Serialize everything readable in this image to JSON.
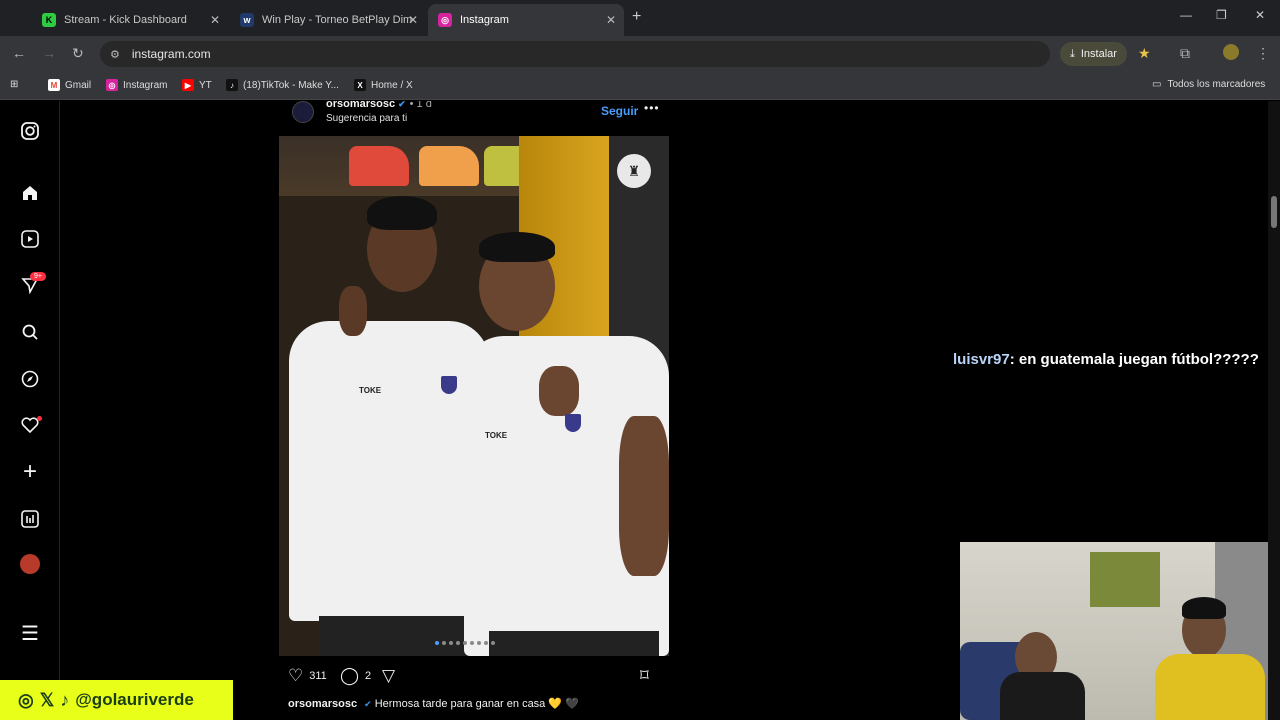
{
  "browser": {
    "tabs": [
      {
        "title": "Stream - Kick Dashboard",
        "icon": "kick-icon",
        "fav_letter": "K",
        "fav_color": "#2ecc40"
      },
      {
        "title": "Win Play - Torneo BetPlay Dima",
        "icon": "winplay-icon",
        "fav_letter": "w",
        "fav_color": "#203a6a"
      },
      {
        "title": "Instagram",
        "icon": "instagram-icon",
        "fav_letter": "◎",
        "fav_color": "#d6249f"
      }
    ],
    "active_tab": 2,
    "url": "instagram.com",
    "install_label": "Instalar",
    "bookmarks": [
      {
        "label": "Gmail",
        "letter": "M",
        "color": "#ea4335"
      },
      {
        "label": "Instagram",
        "letter": "◎",
        "color": "#d6249f"
      },
      {
        "label": "YT",
        "letter": "▶",
        "color": "#ff0000"
      },
      {
        "label": "(18)TikTok - Make Y...",
        "letter": "♪",
        "color": "#111111"
      },
      {
        "label": "Home / X",
        "letter": "X",
        "color": "#111111"
      }
    ],
    "all_bookmarks_label": "Todos los marcadores"
  },
  "sidebar": {
    "notification_badge": "9+"
  },
  "post": {
    "username": "orsomarsosc",
    "time": "• 1 d",
    "suggestion": "Sugerencia para ti",
    "follow_label": "Seguir",
    "more_label": "•••",
    "likes": "311",
    "comments": "2",
    "caption_user": "orsomarsosc",
    "caption_text": "Hermosa tarde para ganar en casa 💛 🖤",
    "carousel_count": 9,
    "carousel_active": 0
  },
  "overlay": {
    "chat_user": "luisvr97",
    "chat_message": ": en guatemala juegan fútbol?????",
    "social_handle": "@golauriverde"
  },
  "colors": {
    "accent_blue": "#4a9df8",
    "badge_red": "#ff3040",
    "social_yellow": "#e8ff1a"
  }
}
